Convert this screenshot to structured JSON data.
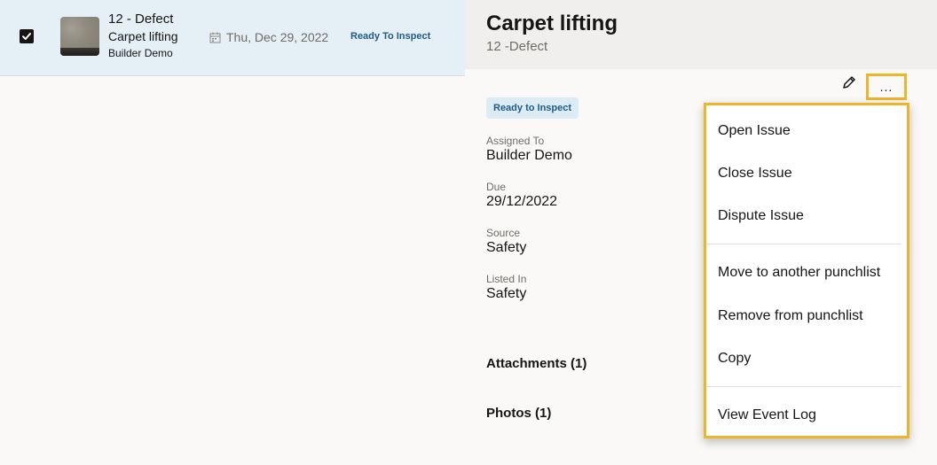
{
  "list": {
    "row": {
      "title": "12 - Defect",
      "subtitle": "Carpet lifting",
      "assignee": "Builder Demo",
      "date": "Thu, Dec 29, 2022",
      "status": "Ready To Inspect",
      "checked": true
    }
  },
  "detail": {
    "title": "Carpet lifting",
    "subtitle": "12 -Defect",
    "status_chip": "Ready to Inspect",
    "fields": [
      {
        "label": "Assigned To",
        "value": "Builder Demo"
      },
      {
        "label": "Due",
        "value": "29/12/2022"
      },
      {
        "label": "Source",
        "value": "Safety"
      },
      {
        "label": "Listed In",
        "value": "Safety"
      }
    ],
    "attachments": "Attachments (1)",
    "photos": "Photos (1)",
    "more_label": "..."
  },
  "menu": {
    "items": [
      "Open Issue",
      "Close Issue",
      "Dispute Issue",
      "Move to another punchlist",
      "Remove from punchlist",
      "Copy",
      "View Event Log"
    ]
  },
  "icons": {
    "checkbox": "check-icon",
    "calendar": "calendar-icon",
    "edit": "pencil-icon",
    "more": "ellipsis-icon"
  },
  "colors": {
    "selected_row": "#e4f0f6",
    "status_text": "#1f5b83",
    "status_chip_bg": "#dcecf5",
    "highlight": "#f0b429"
  }
}
